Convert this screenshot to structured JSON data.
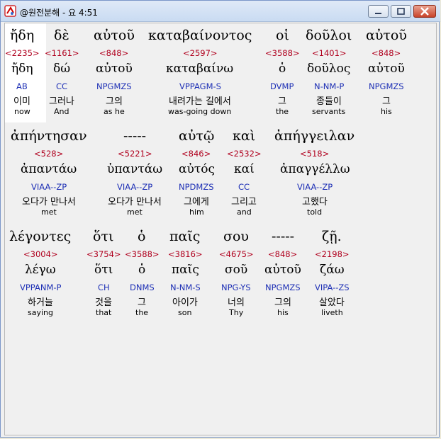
{
  "window": {
    "title": "@원전분해 - 요 4:51",
    "buttons": {
      "minimize": "",
      "maximize": "",
      "close": ""
    }
  },
  "lines": [
    {
      "words": [
        {
          "greek": "ἤδη",
          "strong": "<2235>",
          "lemma": "ἤδη",
          "parse": "AB",
          "korean": "이미",
          "english": "now"
        },
        {
          "greek": "δὲ",
          "strong": "<1161>",
          "lemma": "δώ",
          "parse": "CC",
          "korean": "그러나",
          "english": "And"
        },
        {
          "greek": "αὐτοῦ",
          "strong": "<848>",
          "lemma": "αὐτοῦ",
          "parse": "NPGMZS",
          "korean": "그의",
          "english": "as he"
        },
        {
          "greek": "καταβαίνοντος",
          "strong": "<2597>",
          "lemma": "καταβαίνω",
          "parse": "VPPAGM-S",
          "korean": "내려가는 길에서",
          "english": "was-going down"
        },
        {
          "greek": "οἱ",
          "strong": "<3588>",
          "lemma": "ὁ",
          "parse": "DVMP",
          "korean": "그",
          "english": "the"
        },
        {
          "greek": "δοῦλοι",
          "strong": "<1401>",
          "lemma": "δοῦλος",
          "parse": "N-NM-P",
          "korean": "종들이",
          "english": "servants"
        },
        {
          "greek": "αὐτοῦ",
          "strong": "<848>",
          "lemma": "αὐτοῦ",
          "parse": "NPGMZS",
          "korean": "그",
          "english": "his"
        }
      ]
    },
    {
      "words": [
        {
          "greek": "ἀπήντησαν",
          "strong": "<528>",
          "lemma": "ἀπαντάω",
          "parse": "VIAA--ZP",
          "korean": "오다가 만나서",
          "english": "met"
        },
        {
          "greek": "-----",
          "strong": "<5221>",
          "lemma": "ὑπαντάω",
          "parse": "VIAA--ZP",
          "korean": "오다가 만나서",
          "english": "met"
        },
        {
          "greek": "αὐτῷ",
          "strong": "<846>",
          "lemma": "αὐτός",
          "parse": "NPDMZS",
          "korean": "그에게",
          "english": "him"
        },
        {
          "greek": "καὶ",
          "strong": "<2532>",
          "lemma": "καί",
          "parse": "CC",
          "korean": "그리고",
          "english": "and"
        },
        {
          "greek": "ἀπήγγειλαν",
          "strong": "<518>",
          "lemma": "ἀπαγγέλλω",
          "parse": "VIAA--ZP",
          "korean": "고했다",
          "english": "told"
        }
      ]
    },
    {
      "words": [
        {
          "greek": "λέγοντες",
          "strong": "<3004>",
          "lemma": "λέγω",
          "parse": "VPPANM-P",
          "korean": "하거늘",
          "english": "saying"
        },
        {
          "greek": "ὅτι",
          "strong": "<3754>",
          "lemma": "ὅτι",
          "parse": "CH",
          "korean": "것을",
          "english": "that"
        },
        {
          "greek": "ὁ",
          "strong": "<3588>",
          "lemma": "ὁ",
          "parse": "DNMS",
          "korean": "그",
          "english": "the"
        },
        {
          "greek": "παῖς",
          "strong": "<3816>",
          "lemma": "παῖς",
          "parse": "N-NM-S",
          "korean": "아이가",
          "english": "son"
        },
        {
          "greek": "σου",
          "strong": "<4675>",
          "lemma": "σοῦ",
          "parse": "NPG-YS",
          "korean": "너의",
          "english": "Thy"
        },
        {
          "greek": "-----",
          "strong": "<848>",
          "lemma": "αὐτοῦ",
          "parse": "NPGMZS",
          "korean": "그의",
          "english": "his"
        },
        {
          "greek": "ζῇ.",
          "strong": "<2198>",
          "lemma": "ζάω",
          "parse": "VIPA--ZS",
          "korean": "살았다",
          "english": "liveth"
        }
      ]
    }
  ]
}
